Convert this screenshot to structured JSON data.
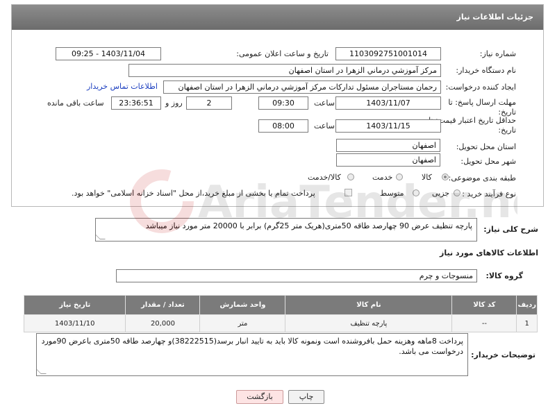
{
  "header": {
    "title": "جزئیات اطلاعات نیاز"
  },
  "fields": {
    "need_number_label": "شماره نیاز:",
    "need_number": "1103092751001014",
    "announce_label": "تاریخ و ساعت اعلان عمومی:",
    "announce_value": "1403/11/04 - 09:25",
    "buyer_org_label": "نام دستگاه خریدار:",
    "buyer_org": "مرکز آموزشي درماني الزهرا در استان اصفهان",
    "creator_label": "ایجاد کننده درخواست:",
    "creator": "رحمان مستاجران مسئول تدارکات مرکز آموزشي درماني الزهرا در استان اصفهان",
    "contact_link": "اطلاعات تماس خریدار",
    "deadline_label_1": "مهلت ارسال پاسخ: تا",
    "deadline_label_2": "تاریخ:",
    "deadline_date": "1403/11/07",
    "time_label": "ساعت",
    "deadline_time": "09:30",
    "days_value": "2",
    "days_label": "روز و",
    "remaining_value": "23:36:51",
    "remaining_label": "ساعت باقی مانده",
    "validity_label_1": "حداقل تاریخ اعتبار قیمت: تا",
    "validity_label_2": "تاریخ:",
    "validity_date": "1403/11/15",
    "validity_time": "08:00",
    "province_label": "استان محل تحویل:",
    "province": "اصفهان",
    "city_label": "شهر محل تحویل:",
    "city": "اصفهان",
    "category_label": "طبقه بندی موضوعی:",
    "category_options": [
      "کالا",
      "خدمت",
      "کالا/خدمت"
    ],
    "category_selected": "کالا",
    "process_label": "نوع فرآیند خرید :",
    "process_options": [
      "جزیی",
      "متوسط"
    ],
    "process_note": "پرداخت تمام یا بخشی از مبلغ خرید،از محل \"اسناد خزانه اسلامی\" خواهد بود."
  },
  "description": {
    "label": "شرح کلی نیاز:",
    "text": "پارچه تنظیف عرض 90 چهارصد طاقه 50متری(هریک متر 25گرم) برابر با 20000 متر مورد نیاز میباشد"
  },
  "goods": {
    "section_title": "اطلاعات کالاهای مورد نیاز",
    "group_label": "گروه کالا:",
    "group_value": "منسوجات و چرم",
    "columns": [
      "ردیف",
      "کد کالا",
      "نام کالا",
      "واحد شمارش",
      "تعداد / مقدار",
      "تاریخ نیاز"
    ],
    "rows": [
      [
        "1",
        "--",
        "پارچه تنظیف",
        "متر",
        "20,000",
        "1403/11/10"
      ]
    ]
  },
  "buyer_notes": {
    "label": "توضیحات خریدار:",
    "text": "پرداخت 8ماهه وهزینه حمل بافروشنده  است ونمونه کالا باید به تایید انبار برسد(38222515)و چهارصد طاقه 50متری باعرض 90مورد درخواست می باشد."
  },
  "buttons": {
    "print": "چاپ",
    "back": "بازگشت"
  },
  "watermark": {
    "text": "AriaTender.neT"
  }
}
